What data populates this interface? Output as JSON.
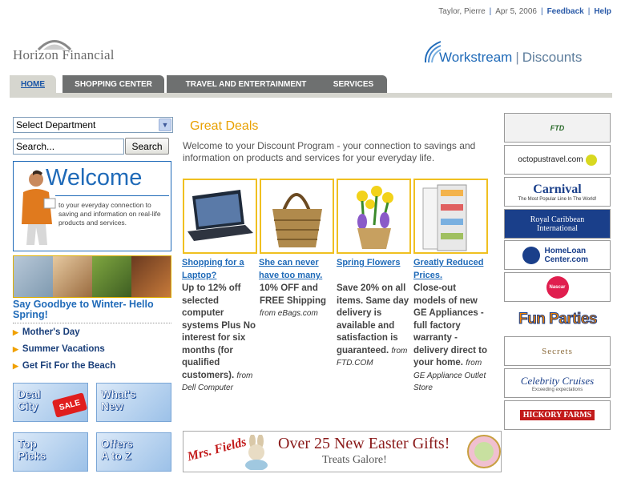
{
  "header": {
    "user": "Taylor, Pierre",
    "date": "Apr 5, 2006",
    "feedback": "Feedback",
    "help": "Help",
    "left_logo": "Horizon Financial",
    "right_logo_main": "Workstream",
    "right_logo_sub": "Discounts"
  },
  "tabs": [
    {
      "label": "HOME",
      "active": true
    },
    {
      "label": "SHOPPING CENTER"
    },
    {
      "label": "TRAVEL AND ENTERTAINMENT"
    },
    {
      "label": "SERVICES"
    }
  ],
  "sidebar": {
    "department_select": "Select Department",
    "search_placeholder": "Search...",
    "search_button": "Search",
    "welcome_title": "Welcome",
    "welcome_text": "to your everyday connection to saving and information on real-life products and services.",
    "spring_title": "Say Goodbye to Winter- Hello Spring!",
    "spring_items": [
      "Mother's Day",
      "Summer Vacations",
      "Get Fit For the Beach"
    ],
    "promos": [
      "Deal City",
      "What's New",
      "Top Picks",
      "Offers A to Z"
    ],
    "promo_sale_tag": "SALE"
  },
  "main": {
    "title": "Great Deals",
    "intro": "Welcome to your Discount Program - your connection to savings and information on products and services for your everyday life.",
    "deals": [
      {
        "link": "Shopping for a Laptop?",
        "desc": "Up to 12% off selected computer systems Plus No interest for six months (for qualified customers).",
        "from": "from Dell Computer"
      },
      {
        "link": "She can never have too many.",
        "desc": "10% OFF and FREE Shipping",
        "from": "from eBags.com"
      },
      {
        "link": "Spring Flowers",
        "desc": "Save 20% on all items. Same day delivery is available and satisfaction is guaranteed.",
        "from": "from FTD.COM"
      },
      {
        "link": "Greatly Reduced Prices.",
        "desc": "Close-out models of new GE Appliances - full factory warranty - delivery direct to your home.",
        "from": "from GE Appliance Outlet Store"
      }
    ],
    "banner": {
      "brand": "Mrs. Fields",
      "headline": "Over 25 New Easter Gifts!",
      "sub": "Treats Galore!"
    }
  },
  "sponsors": [
    "FTD",
    "octopustravel.com",
    "Carnival",
    "Royal Caribbean International",
    "HomeLoan Center.com",
    "Nascar",
    "Fun Parties",
    "Secrets",
    "Celebrity Cruises",
    "HICKORY FARMS"
  ],
  "sponsor_tags": {
    "carnival": "The Most Popular Line In The World!",
    "celebrity": "Exceeding expectations"
  }
}
